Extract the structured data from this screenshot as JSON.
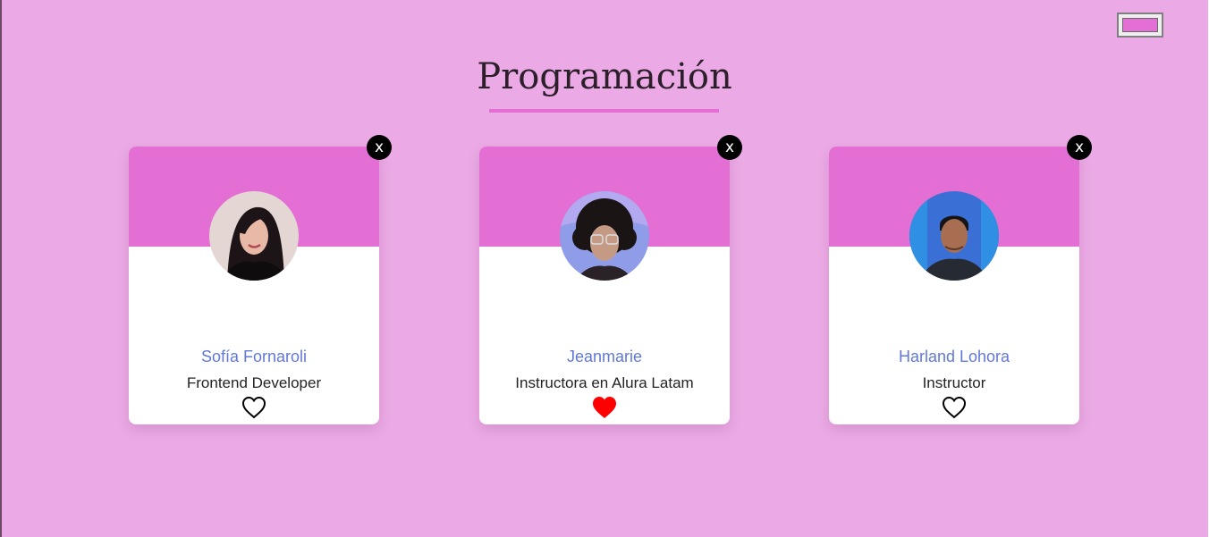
{
  "team": {
    "title": "Programación",
    "primary_color": "#e36fd4",
    "secondary_color": "#ebaae5"
  },
  "color_picker": {
    "value": "#e36fd4"
  },
  "cards": [
    {
      "name": "Sofía Fornaroli",
      "role": "Frontend Developer",
      "favorite": false,
      "avatar_icon": "woman-portrait"
    },
    {
      "name": "Jeanmarie",
      "role": "Instructora en Alura Latam",
      "favorite": true,
      "avatar_icon": "woman-curly-hair-portrait"
    },
    {
      "name": "Harland Lohora",
      "role": "Instructor",
      "favorite": false,
      "avatar_icon": "man-portrait"
    }
  ],
  "icons": {
    "delete": "close-icon",
    "favorite_on": "heart-filled-icon",
    "favorite_off": "heart-outline-icon"
  },
  "colors": {
    "name_text": "#6278d8",
    "heart_filled": "#ff0000",
    "delete_bg": "#000000"
  },
  "delete_symbol": "x"
}
